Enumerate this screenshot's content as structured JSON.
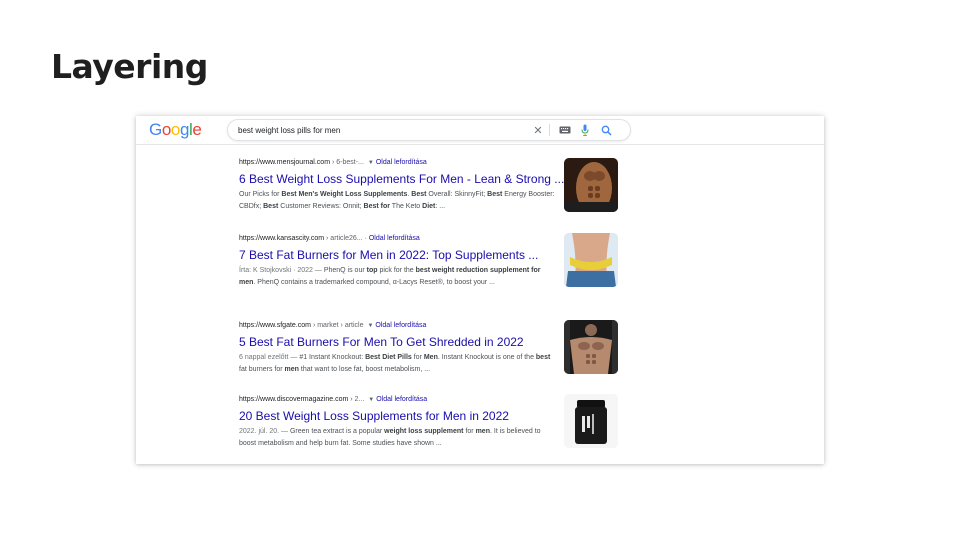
{
  "slide": {
    "title": "Layering"
  },
  "header": {
    "logo_letters": [
      {
        "char": "G",
        "color": "#4285F4"
      },
      {
        "char": "o",
        "color": "#EA4335"
      },
      {
        "char": "o",
        "color": "#FBBC05"
      },
      {
        "char": "g",
        "color": "#4285F4"
      },
      {
        "char": "l",
        "color": "#34A853"
      },
      {
        "char": "e",
        "color": "#EA4335"
      }
    ],
    "search_value": "best weight loss pills for men",
    "icons": [
      "clear-icon",
      "keyboard-icon",
      "mic-icon",
      "google-lens-search-icon"
    ]
  },
  "results": [
    {
      "site": "https://www.mensjournal.com",
      "path": "› 6-best-...",
      "translate": "Oldal lefordítása",
      "title": "6 Best Weight Loss Supplements For Men - Lean & Strong ...",
      "snippet_parts": [
        {
          "t": "Our Picks for ",
          "b": false
        },
        {
          "t": "Best Men's Weight Loss Supplements",
          "b": true
        },
        {
          "t": ". ",
          "b": false
        },
        {
          "t": "Best",
          "b": true
        },
        {
          "t": " Overall: SkinnyFit; ",
          "b": false
        },
        {
          "t": "Best",
          "b": true
        },
        {
          "t": " Energy Booster: CBDfx; ",
          "b": false
        },
        {
          "t": "Best",
          "b": true
        },
        {
          "t": " Customer Reviews: Onnit; ",
          "b": false
        },
        {
          "t": "Best for",
          "b": true
        },
        {
          "t": " The Keto ",
          "b": false
        },
        {
          "t": "Diet",
          "b": true
        },
        {
          "t": ": ...",
          "b": false
        }
      ],
      "image": "muscular-torso-photo"
    },
    {
      "site": "https://www.kansascity.com",
      "path": "› article26...",
      "translate": "Oldal lefordítása",
      "title": "7 Best Fat Burners for Men in 2022: Top Supplements ...",
      "snippet_parts": [
        {
          "t": "Írta: K Stojkovski · 2022 — ",
          "b": false,
          "date": true
        },
        {
          "t": "PhenQ is our ",
          "b": false
        },
        {
          "t": "top",
          "b": true
        },
        {
          "t": " pick for the ",
          "b": false
        },
        {
          "t": "best weight reduction supplement for men",
          "b": true
        },
        {
          "t": ". PhenQ contains a trademarked compound, α-Lacys Reset®, to boost your ...",
          "b": false
        }
      ],
      "image": "waist-measuring-tape-photo"
    },
    {
      "site": "https://www.sfgate.com",
      "path": "› market › article",
      "translate": "Oldal lefordítása",
      "title": "5 Best Fat Burners For Men To Get Shredded in 2022",
      "snippet_parts": [
        {
          "t": "6 nappal ezelőtt — ",
          "b": false,
          "date": true
        },
        {
          "t": "#1 Instant Knockout: ",
          "b": false
        },
        {
          "t": "Best Diet Pills",
          "b": true
        },
        {
          "t": " for ",
          "b": false
        },
        {
          "t": "Men",
          "b": true
        },
        {
          "t": ". Instant Knockout is one of the ",
          "b": false
        },
        {
          "t": "best",
          "b": true
        },
        {
          "t": " fat burners for ",
          "b": false
        },
        {
          "t": "men",
          "b": true
        },
        {
          "t": " that want to lose fat, boost metabolism, ...",
          "b": false
        }
      ],
      "image": "bodybuilder-photo"
    },
    {
      "site": "https://www.discovermagazine.com",
      "path": "› 2...",
      "translate": "Oldal lefordítása",
      "title": "20 Best Weight Loss Supplements for Men in 2022",
      "snippet_parts": [
        {
          "t": "2022. júl. 20. — ",
          "b": false,
          "date": true
        },
        {
          "t": "Green tea extract is a popular ",
          "b": false
        },
        {
          "t": "weight loss supplement",
          "b": true
        },
        {
          "t": " for ",
          "b": false
        },
        {
          "t": "men",
          "b": true
        },
        {
          "t": ". It is believed to boost metabolism and help burn fat. Some studies have shown ...",
          "b": false
        }
      ],
      "image": "supplement-jar-photo"
    }
  ]
}
